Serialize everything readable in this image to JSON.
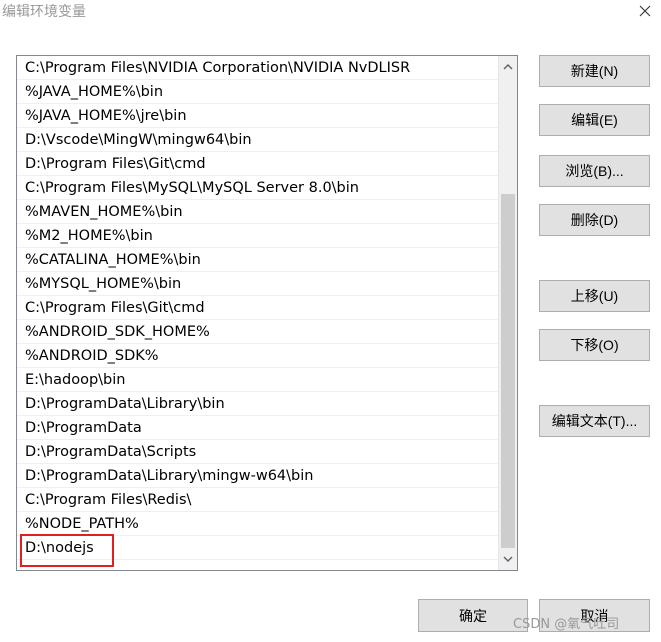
{
  "window": {
    "title": "编辑环境变量",
    "close_glyph": "✕"
  },
  "path_list": {
    "items": [
      "C:\\Program Files\\NVIDIA Corporation\\NVIDIA NvDLISR",
      "%JAVA_HOME%\\bin",
      "%JAVA_HOME%\\jre\\bin",
      "D:\\Vscode\\MingW\\mingw64\\bin",
      "D:\\Program Files\\Git\\cmd",
      "C:\\Program Files\\MySQL\\MySQL Server 8.0\\bin",
      "%MAVEN_HOME%\\bin",
      "%M2_HOME%\\bin",
      "%CATALINA_HOME%\\bin",
      "%MYSQL_HOME%\\bin",
      "C:\\Program Files\\Git\\cmd",
      "%ANDROID_SDK_HOME%",
      "%ANDROID_SDK%",
      "E:\\hadoop\\bin",
      "D:\\ProgramData\\Library\\bin",
      "D:\\ProgramData",
      "D:\\ProgramData\\Scripts",
      "D:\\ProgramData\\Library\\mingw-w64\\bin",
      "C:\\Program Files\\Redis\\",
      "%NODE_PATH%",
      "D:\\nodejs"
    ],
    "highlight_color": "#e02020"
  },
  "buttons": {
    "new": "新建(N)",
    "edit": "编辑(E)",
    "browse": "浏览(B)...",
    "delete": "删除(D)",
    "move_up": "上移(U)",
    "move_down": "下移(O)",
    "edit_text": "编辑文本(T)...",
    "ok": "确定",
    "cancel": "取消"
  },
  "watermark": "CSDN @氧气吐司"
}
